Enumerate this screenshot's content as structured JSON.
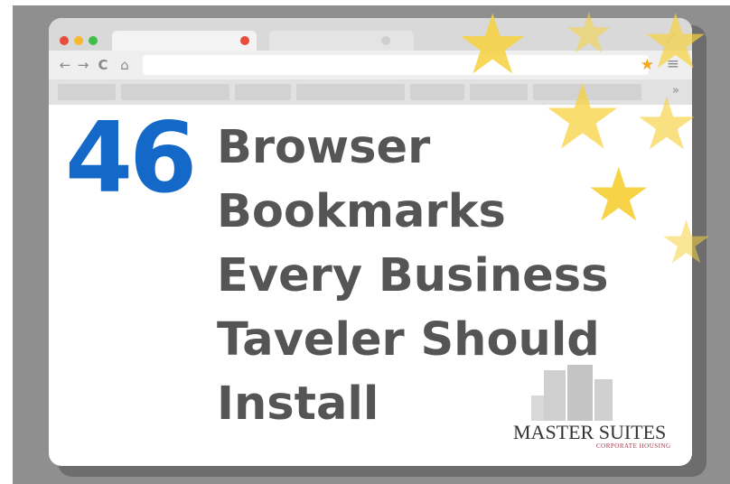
{
  "graphic": {
    "count": "46",
    "title_lines": [
      "Browser",
      "Bookmarks",
      "Every Business",
      "Taveler Should",
      "Install"
    ],
    "count_color": "#1468c8",
    "title_color": "#555555"
  },
  "browser": {
    "traffic_lights": [
      "close-dot",
      "minimize-dot",
      "maximize-dot"
    ],
    "nav_icons": {
      "back": "←",
      "forward": "→",
      "reload": "C",
      "home": "⌂"
    },
    "star_icon": "★",
    "menu_icon": "≡",
    "bookmarks_overflow": "»",
    "resize_icon": "⤢"
  },
  "logo": {
    "name": "MASTER SUITES",
    "tagline": "CORPORATE HOUSING"
  },
  "colors": {
    "background": "#8f8f8f",
    "star": "#f7d23e",
    "accent_blue": "#1468c8"
  }
}
